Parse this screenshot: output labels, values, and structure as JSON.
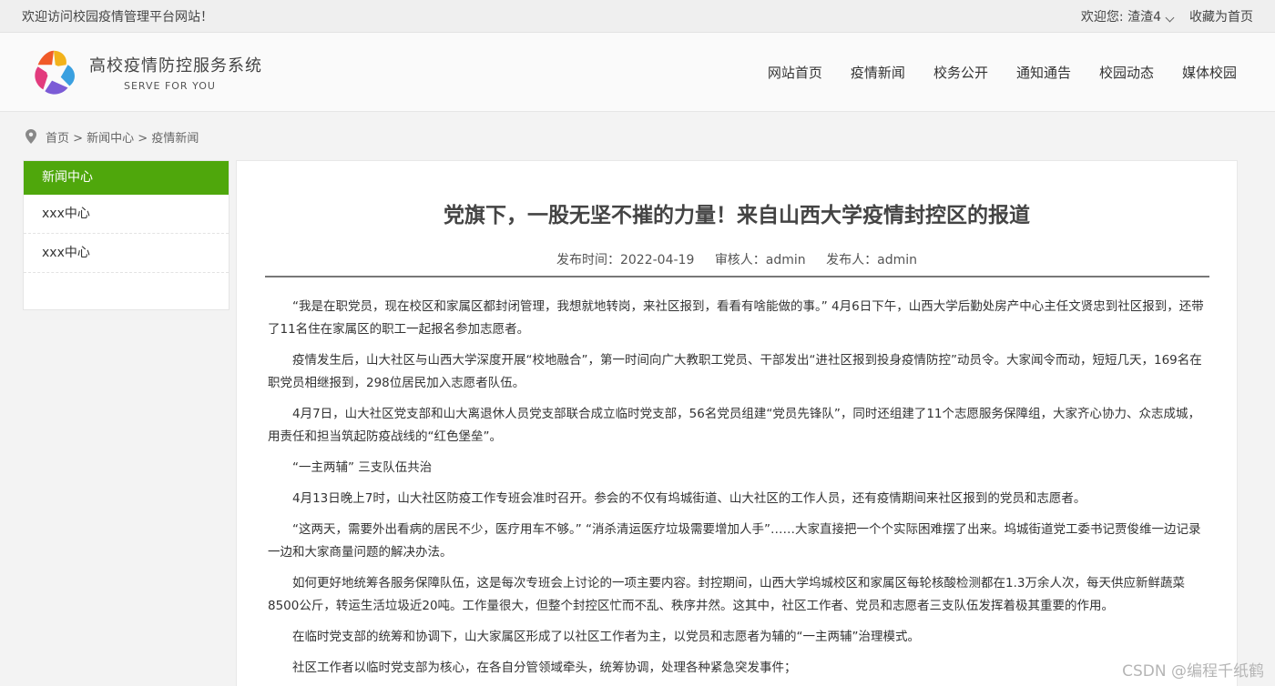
{
  "topbar": {
    "welcome": "欢迎访问校园疫情管理平台网站！",
    "greeting": "欢迎您: 渣渣4",
    "bookmark": "收藏为首页"
  },
  "brand": {
    "title": "高校疫情防控服务系统",
    "subtitle": "SERVE FOR YOU"
  },
  "nav": [
    "网站首页",
    "疫情新闻",
    "校务公开",
    "通知通告",
    "校园动态",
    "媒体校园"
  ],
  "breadcrumb": "首页 > 新闻中心 > 疫情新闻",
  "sidebar": {
    "header": "新闻中心",
    "items": [
      "xxx中心",
      "xxx中心"
    ]
  },
  "article": {
    "title": "党旗下，一股无坚不摧的力量！来自山西大学疫情封控区的报道",
    "published": "发布时间：2022-04-19",
    "reviewer": "审核人：admin",
    "publisher": "发布人：admin",
    "paragraphs": [
      "“我是在职党员，现在校区和家属区都封闭管理，我想就地转岗，来社区报到，看看有啥能做的事。” 4月6日下午，山西大学后勤处房产中心主任文贤忠到社区报到，还带了11名住在家属区的职工一起报名参加志愿者。",
      "疫情发生后，山大社区与山西大学深度开展“校地融合”，第一时间向广大教职工党员、干部发出“进社区报到投身疫情防控”动员令。大家闻令而动，短短几天，169名在职党员相继报到，298位居民加入志愿者队伍。",
      "4月7日，山大社区党支部和山大离退休人员党支部联合成立临时党支部，56名党员组建“党员先锋队”，同时还组建了11个志愿服务保障组，大家齐心协力、众志成城，用责任和担当筑起防疫战线的“红色堡垒”。",
      "“一主两辅” 三支队伍共治",
      "4月13日晚上7时，山大社区防疫工作专班会准时召开。参会的不仅有坞城街道、山大社区的工作人员，还有疫情期间来社区报到的党员和志愿者。",
      "“这两天，需要外出看病的居民不少，医疗用车不够。” “消杀清运医疗垃圾需要增加人手”……大家直接把一个个实际困难摆了出来。坞城街道党工委书记贾俊维一边记录一边和大家商量问题的解决办法。",
      "如何更好地统筹各服务保障队伍，这是每次专班会上讨论的一项主要内容。封控期间，山西大学坞城校区和家属区每轮核酸检测都在1.3万余人次，每天供应新鲜蔬菜8500公斤，转运生活垃圾近20吨。工作量很大，但整个封控区忙而不乱、秩序井然。这其中，社区工作者、党员和志愿者三支队伍发挥着极其重要的作用。",
      "在临时党支部的统筹和协调下，山大家属区形成了以社区工作者为主，以党员和志愿者为辅的“一主两辅”治理模式。",
      "社区工作者以临时党支部为核心，在各自分管领域牵头，统筹协调，处理各种紧急突发事件；"
    ]
  },
  "watermark": "CSDN @编程千纸鹤",
  "colors": {
    "accent": "#4fa70c"
  }
}
